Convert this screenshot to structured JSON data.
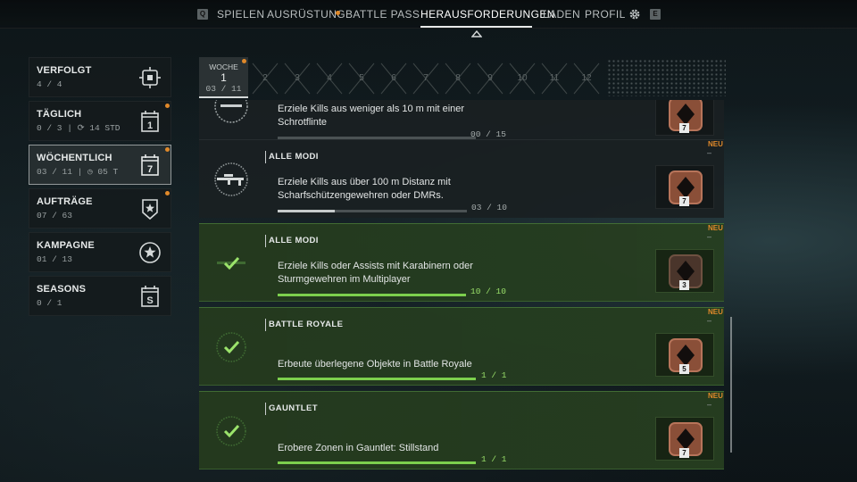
{
  "nav": {
    "left_key": "Q",
    "right_key": "E",
    "items": [
      "SPIELEN",
      "AUSRÜSTUNG",
      "BATTLE PASS",
      "HERAUSFORDERUNGEN",
      "LADEN",
      "PROFIL"
    ],
    "active": "HERAUSFORDERUNGEN"
  },
  "sidebar": {
    "items": [
      {
        "label": "VERFOLGT",
        "sub": "4 / 4",
        "icon": "target-icon"
      },
      {
        "label": "TÄGLICH",
        "sub": "0 / 3 | ⟳ 14 STD",
        "icon": "calendar-1-icon",
        "icon_text": "1",
        "new": true
      },
      {
        "label": "WÖCHENTLICH",
        "sub": "03 / 11 | ◷ 05 T",
        "icon": "calendar-7-icon",
        "icon_text": "7",
        "new": true,
        "active": true
      },
      {
        "label": "AUFTRÄGE",
        "sub": "07 / 63",
        "icon": "star-badge-icon",
        "new": true
      },
      {
        "label": "KAMPAGNE",
        "sub": "01 / 13",
        "icon": "campaign-star-icon"
      },
      {
        "label": "SEASONS",
        "sub": "0 / 1",
        "icon": "calendar-s-icon",
        "icon_text": "S"
      }
    ]
  },
  "weeks": {
    "active": {
      "label": "WOCHE",
      "number": "1",
      "progress": "03 / 11"
    },
    "locked": [
      "2",
      "3",
      "4",
      "5",
      "6",
      "7",
      "8",
      "9",
      "10",
      "11",
      "12"
    ]
  },
  "challenges": [
    {
      "mode": "",
      "desc": "Erziele Kills aus weniger als 10 m mit einer Schrotflinte",
      "count": "00 / 15",
      "progress": 0.0,
      "reward_level": "7",
      "done": false,
      "new": false
    },
    {
      "mode": "ALLE MODI",
      "desc": "Erziele Kills aus über 100 m Distanz mit Scharfschützengewehren oder DMRs.",
      "count": "03 / 10",
      "progress": 0.3,
      "reward_level": "7",
      "done": false,
      "new": true
    },
    {
      "mode": "ALLE MODI",
      "desc": "Erziele Kills oder Assists mit Karabinern oder Sturmgewehren im Multiplayer",
      "count": "10 / 10",
      "progress": 1.0,
      "reward_level": "3",
      "done": true,
      "new": true
    },
    {
      "mode": "BATTLE ROYALE",
      "desc": "Erbeute überlegene Objekte in Battle Royale",
      "count": "1 / 1",
      "progress": 1.0,
      "reward_level": "5",
      "done": true,
      "new": true
    },
    {
      "mode": "GAUNTLET",
      "desc": "Erobere Zonen in Gauntlet: Stillstand",
      "count": "1 / 1",
      "progress": 1.0,
      "reward_level": "7",
      "done": true,
      "new": true
    }
  ],
  "new_label": "NEU",
  "colors": {
    "accent": "#e0892a",
    "complete": "#7ccf4d"
  }
}
